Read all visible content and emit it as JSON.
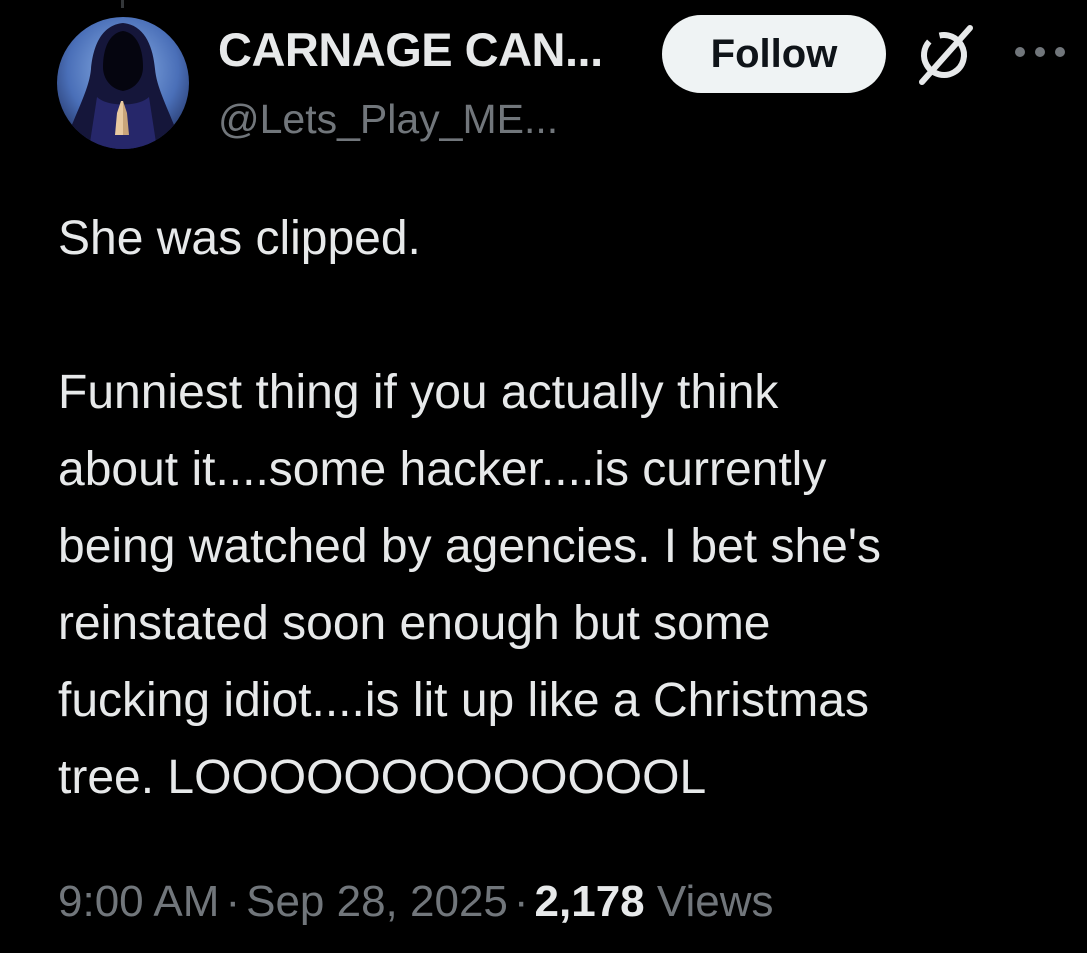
{
  "author": {
    "display_name": "CARNAGE CAN...",
    "handle": "@Lets_Play_ME..."
  },
  "actions": {
    "follow_label": "Follow",
    "grok_icon": "grok-icon",
    "more_icon": "more-icon"
  },
  "tweet": {
    "paragraphs": [
      "She was clipped.",
      "Funniest thing if you actually think\nabout it....some hacker....is currently\nbeing watched by agencies. I bet she's\nreinstated soon enough but some\nfucking idiot....is lit up like a Christmas\ntree. LOOOOOOOOOOOOOL"
    ]
  },
  "meta": {
    "time": "9:00 AM",
    "separator": "·",
    "date": "Sep 28, 2025",
    "views_count": "2,178",
    "views_label": "Views"
  },
  "colors": {
    "background": "#000000",
    "primary_text": "#e7e9ea",
    "secondary_text": "#71767b",
    "follow_bg": "#eff3f4",
    "follow_text": "#0f1419"
  }
}
